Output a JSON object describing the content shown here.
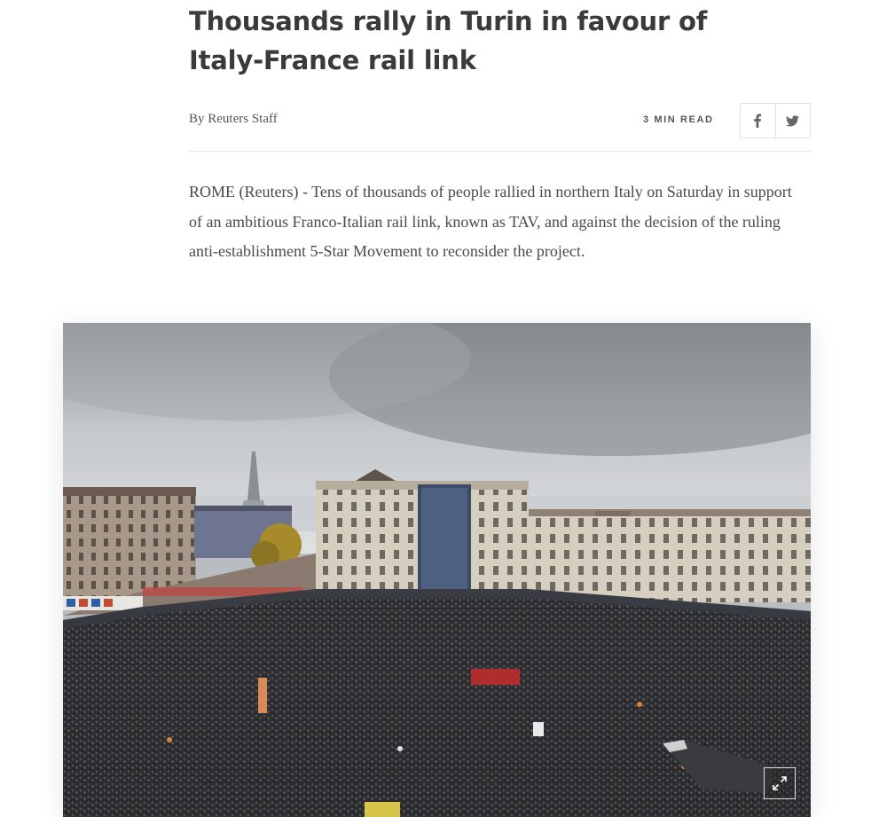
{
  "article": {
    "headline": "Thousands rally in Turin in favour of Italy-France rail link",
    "byline": "By Reuters Staff",
    "read_time": "3 MIN READ",
    "lead": "ROME (Reuters) - Tens of thousands of people rallied in northern Italy on Saturday in support of an ambitious Franco-Italian rail link, known as TAV, and against the decision of the ruling anti-establishment 5-Star Movement to reconsider the project."
  },
  "share": {
    "facebook_icon": "facebook-icon",
    "twitter_icon": "twitter-icon"
  },
  "photo": {
    "subject": "crowd-in-piazza-castello-turin",
    "expand_icon": "expand-icon"
  },
  "colors": {
    "headline": "#3a3a3a",
    "body_text": "#4a4a4a",
    "meta_text": "#555555",
    "border": "#e2e2e2"
  }
}
